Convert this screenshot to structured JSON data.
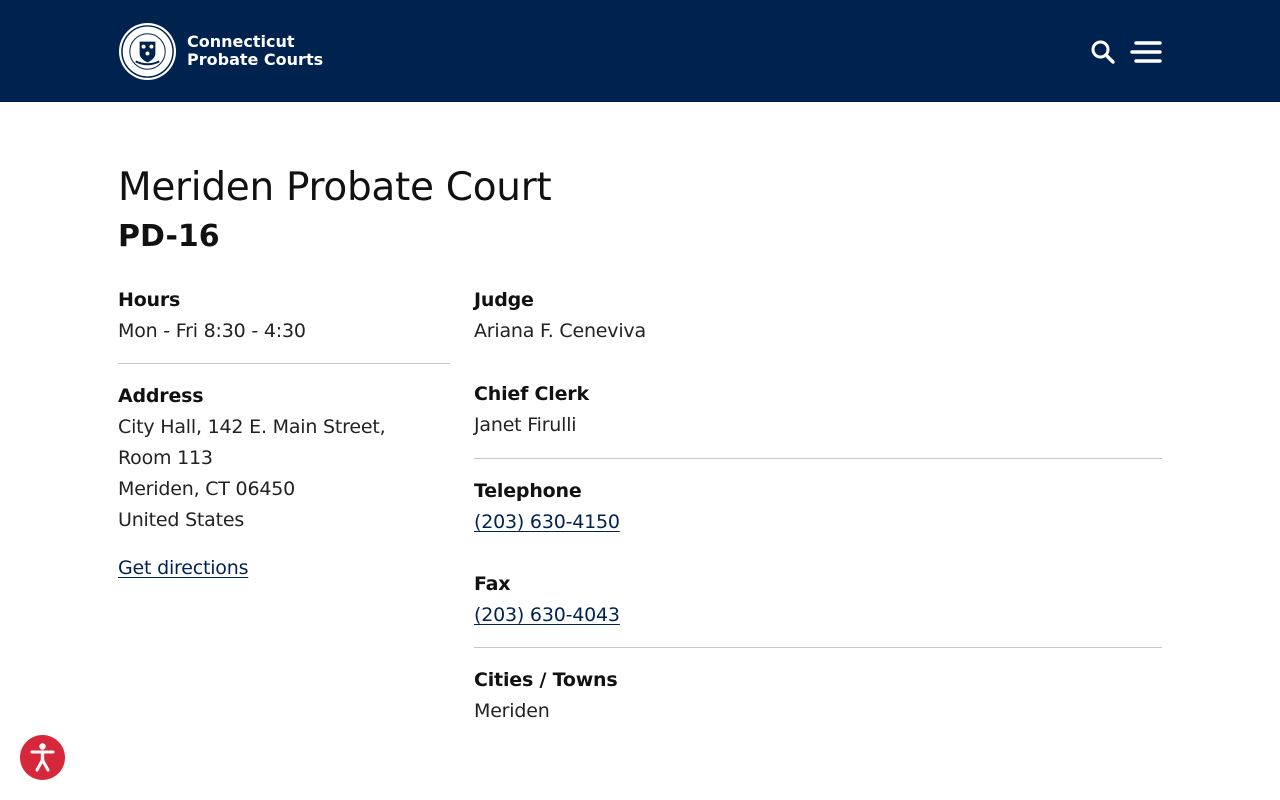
{
  "header": {
    "brand_line1": "Connecticut",
    "brand_line2": "Probate Courts",
    "seal_text": "CONNECTICUT PROBATE COURTS",
    "colors": {
      "background": "#00224f",
      "text": "#ffffff"
    },
    "icons": [
      "seal-logo-icon",
      "search-icon",
      "hamburger-menu-icon"
    ]
  },
  "page": {
    "title": "Meriden Probate Court",
    "subtitle": "PD-16"
  },
  "left": {
    "hours_label": "Hours",
    "hours_value": "Mon - Fri 8:30 - 4:30",
    "address_label": "Address",
    "address_line1": "City Hall, 142 E. Main Street,",
    "address_line2": "Room 113",
    "address_line3": "Meriden, CT 06450",
    "address_line4": "United States",
    "directions_link": "Get directions"
  },
  "right": {
    "judge_label": "Judge",
    "judge_value": "Ariana F. Ceneviva",
    "clerk_label": "Chief Clerk",
    "clerk_value": "Janet Firulli",
    "telephone_label": "Telephone",
    "telephone_value": "(203) 630-4150",
    "fax_label": "Fax",
    "fax_value": "(203) 630-4043",
    "towns_label": "Cities / Towns",
    "towns_value": "Meriden"
  },
  "accessibility": {
    "icon": "accessibility-icon",
    "color": "#d6283a"
  }
}
